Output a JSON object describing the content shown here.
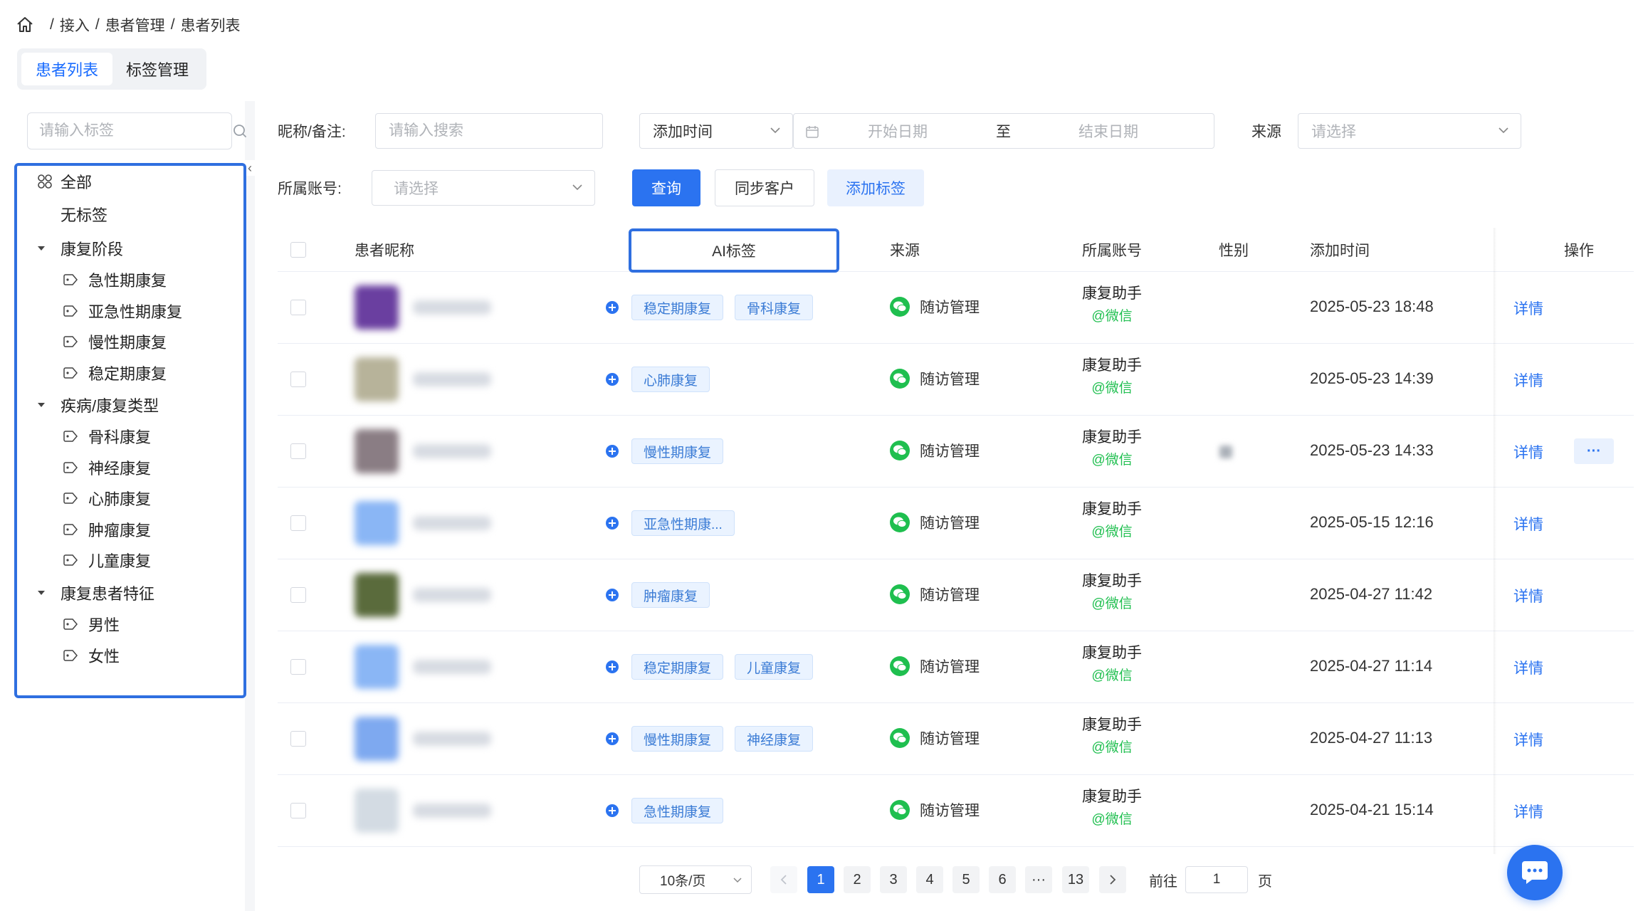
{
  "breadcrumb": {
    "items": [
      "接入",
      "患者管理",
      "患者列表"
    ]
  },
  "page_tabs": [
    {
      "label": "患者列表",
      "active": true
    },
    {
      "label": "标签管理",
      "active": false
    }
  ],
  "sidebar": {
    "search_placeholder": "请输入标签",
    "tree": {
      "all": "全部",
      "untagged": "无标签",
      "groups": [
        {
          "label": "康复阶段",
          "items": [
            "急性期康复",
            "亚急性期康复",
            "慢性期康复",
            "稳定期康复"
          ]
        },
        {
          "label": "疾病/康复类型",
          "items": [
            "骨科康复",
            "神经康复",
            "心肺康复",
            "肿瘤康复",
            "儿童康复"
          ]
        },
        {
          "label": "康复患者特征",
          "items": [
            "男性",
            "女性"
          ]
        }
      ]
    }
  },
  "filters": {
    "nickname_label": "昵称/备注:",
    "nickname_placeholder": "请输入搜索",
    "time_type": "添加时间",
    "start_placeholder": "开始日期",
    "range_sep": "至",
    "end_placeholder": "结束日期",
    "source_label": "来源",
    "source_placeholder": "请选择",
    "account_label": "所属账号:",
    "account_placeholder": "请选择",
    "query_button": "查询",
    "sync_button": "同步客户",
    "add_tag_button": "添加标签"
  },
  "table": {
    "headers": {
      "nickname": "患者昵称",
      "ai_tags": "AI标签",
      "source": "来源",
      "account": "所属账号",
      "gender": "性别",
      "added_time": "添加时间",
      "actions": "操作"
    },
    "detail_label": "详情",
    "more_label": "···",
    "rows": [
      {
        "tags": [
          "稳定期康复",
          "骨科康复"
        ],
        "source": "随访管理",
        "account": "康复助手",
        "channel": "@微信",
        "added_time": "2025-05-23 18:48",
        "avatar_color": "#6a3fa0"
      },
      {
        "tags": [
          "心肺康复"
        ],
        "source": "随访管理",
        "account": "康复助手",
        "channel": "@微信",
        "added_time": "2025-05-23 14:39",
        "avatar_color": "#b7b39a"
      },
      {
        "tags": [
          "慢性期康复"
        ],
        "source": "随访管理",
        "account": "康复助手",
        "channel": "@微信",
        "added_time": "2025-05-23 14:33",
        "avatar_color": "#8a7d84",
        "has_more": true
      },
      {
        "tags": [
          "亚急性期康..."
        ],
        "source": "随访管理",
        "account": "康复助手",
        "channel": "@微信",
        "added_time": "2025-05-15 12:16",
        "avatar_color": "#8ab6f5"
      },
      {
        "tags": [
          "肿瘤康复"
        ],
        "source": "随访管理",
        "account": "康复助手",
        "channel": "@微信",
        "added_time": "2025-04-27 11:42",
        "avatar_color": "#5a6b3c"
      },
      {
        "tags": [
          "稳定期康复",
          "儿童康复"
        ],
        "source": "随访管理",
        "account": "康复助手",
        "channel": "@微信",
        "added_time": "2025-04-27 11:14",
        "avatar_color": "#8ab6f5"
      },
      {
        "tags": [
          "慢性期康复",
          "神经康复"
        ],
        "source": "随访管理",
        "account": "康复助手",
        "channel": "@微信",
        "added_time": "2025-04-27 11:13",
        "avatar_color": "#7ea9f0"
      },
      {
        "tags": [
          "急性期康复"
        ],
        "source": "随访管理",
        "account": "康复助手",
        "channel": "@微信",
        "added_time": "2025-04-21 15:14",
        "avatar_color": "#d3dbe3"
      }
    ]
  },
  "pagination": {
    "page_size": "10条/页",
    "pages": [
      "1",
      "2",
      "3",
      "4",
      "5",
      "6",
      "···",
      "13"
    ],
    "current_page": "1",
    "goto_label": "前往",
    "goto_value": "1",
    "page_suffix": "页"
  },
  "colors": {
    "primary": "#2b73f0",
    "wechat": "#1fbf4f",
    "highlight_border": "#2f6fe0",
    "tag_bg": "#eaf3ff"
  }
}
